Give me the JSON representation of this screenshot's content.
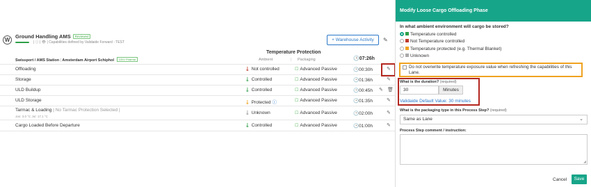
{
  "header": {
    "logo_letter": "W",
    "title": "Ground Handling AMS",
    "status_badge": "Reviewed",
    "subtitle": "| ⓘ | 👁 | Capabilities defined by Validaide Forward - TEST",
    "warehouse_button": "+ Warehouse Activity"
  },
  "table": {
    "group_title": "Temperature Protection",
    "station": {
      "label": "Swissport / AMS Station",
      "separator": "|",
      "airport": "Amsterdam Airport Schiphol",
      "badge": "CEIV Pharma"
    },
    "col_ambient": "Ambient",
    "col_bar": "|",
    "col_packaging": "Packaging",
    "total_time": "07:26h",
    "rows": [
      {
        "name": "Offloading",
        "ambient": "Not controlled",
        "ambient_color": "#c0392b",
        "packaging": "Advanced Passive",
        "time": "00:30h"
      },
      {
        "name": "Storage",
        "ambient": "Controlled",
        "ambient_color": "#2e9f47",
        "packaging": "Advanced Passive",
        "time": "01:36h"
      },
      {
        "name": "ULD Buildup",
        "ambient": "Controlled",
        "ambient_color": "#2e9f47",
        "packaging": "Advanced Passive",
        "time": "00:45h"
      },
      {
        "name": "ULD Storage",
        "ambient": "Protected",
        "ambient_color": "#f0a21f",
        "packaging": "Advanced Passive",
        "time": "01:35h"
      },
      {
        "name": "Tarmac & Loading",
        "name_note": "| No Tarmac Protection Selected |",
        "sub": "Jan: 3.0 °C Jul: 17.1 °C",
        "ambient": "Unknown",
        "ambient_color": "#999999",
        "packaging": "Advanced Passive",
        "time": "02:00h"
      },
      {
        "name": "Cargo Loaded Before Departure",
        "ambient": "Controlled",
        "ambient_color": "#2e9f47",
        "packaging": "Advanced Passive",
        "time": "01:00h"
      }
    ]
  },
  "panel": {
    "title": "Modify Loose Cargo Offloading Phase",
    "question_ambient": "In what ambient environment will cargo be stored?",
    "options": [
      {
        "label": "Temperature controlled",
        "color": "#2e9f47",
        "selected": true
      },
      {
        "label": "Not Temperature controlled",
        "color": "#c0392b",
        "selected": false
      },
      {
        "label": "Temperature protected (e.g. Thermal Blanket)",
        "color": "#f0a21f",
        "selected": false
      },
      {
        "label": "Unknown",
        "color": "#aaaaaa",
        "selected": false
      }
    ],
    "checkbox_label": "Do not overwrite temperature exposure value when refreshing the capabilities of this Lane.",
    "duration_question": "What is the duration?",
    "required": "(required)",
    "duration_value": "30",
    "duration_unit": "Minutes",
    "duration_default": "Validaide Default Value: 30 minutes",
    "packaging_question": "What is the packaging type in this Process Step?",
    "packaging_value": "Same as Lane",
    "comment_question": "Process Step comment / instruction:",
    "cancel_label": "Cancel",
    "save_label": "Save"
  }
}
